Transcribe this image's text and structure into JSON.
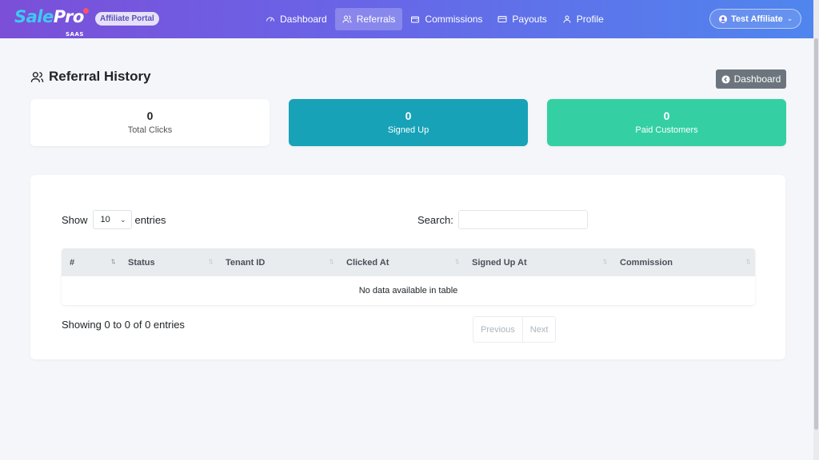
{
  "brand": {
    "logo_sale": "Sale",
    "logo_pro": "Pro",
    "logo_sub": "SAAS",
    "badge": "Affiliate Portal"
  },
  "nav": {
    "items": [
      {
        "label": "Dashboard",
        "icon": "speedometer-icon",
        "active": false
      },
      {
        "label": "Referrals",
        "icon": "users-icon",
        "active": true
      },
      {
        "label": "Commissions",
        "icon": "wallet-icon",
        "active": false
      },
      {
        "label": "Payouts",
        "icon": "credit-card-icon",
        "active": false
      },
      {
        "label": "Profile",
        "icon": "user-icon",
        "active": false
      }
    ],
    "user_label": "Test Affiliate"
  },
  "page": {
    "title": "Referral History",
    "back_label": "Dashboard"
  },
  "stats": [
    {
      "value": "0",
      "label": "Total Clicks"
    },
    {
      "value": "0",
      "label": "Signed Up"
    },
    {
      "value": "0",
      "label": "Paid Customers"
    }
  ],
  "table": {
    "show_label": "Show",
    "entries_label": "entries",
    "page_length": "10",
    "search_label": "Search:",
    "search_value": "",
    "columns": [
      "#",
      "Status",
      "Tenant ID",
      "Clicked At",
      "Signed Up At",
      "Commission"
    ],
    "empty_message": "No data available in table",
    "info": "Showing 0 to 0 of 0 entries",
    "prev_label": "Previous",
    "next_label": "Next"
  },
  "colors": {
    "nav_gradient_start": "#7b4fd8",
    "nav_gradient_end": "#4f86ee",
    "signed_up": "#17a2b8",
    "paid": "#34d0a4",
    "back_button": "#6c757d"
  }
}
